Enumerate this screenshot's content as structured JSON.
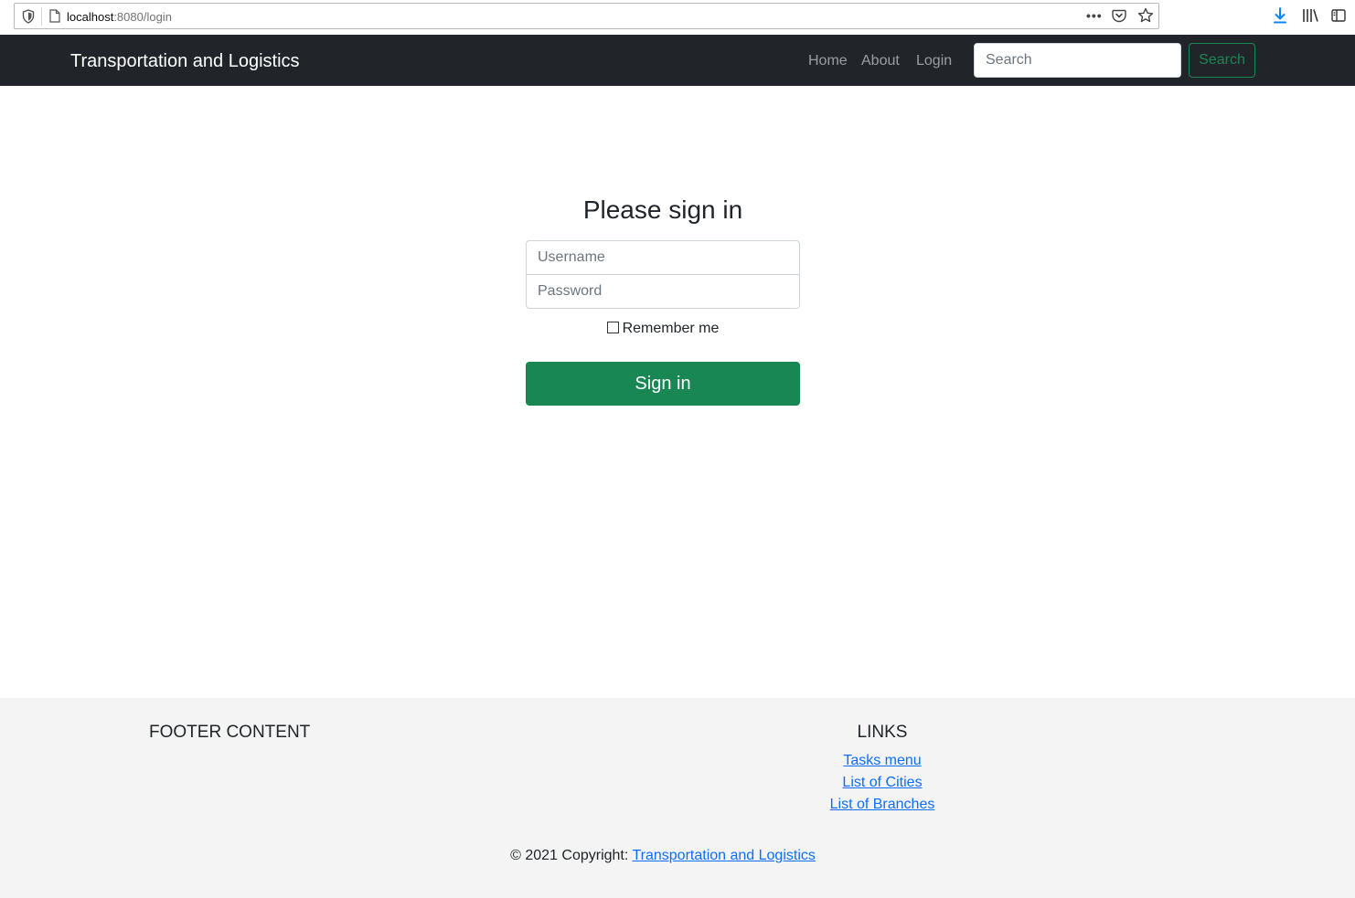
{
  "browser": {
    "url_host": "localhost",
    "url_rest": ":8080/login",
    "more_label": "•••"
  },
  "navbar": {
    "brand": "Transportation and Logistics",
    "links": [
      "Home",
      "About",
      "Login"
    ],
    "search_placeholder": "Search",
    "search_button": "Search"
  },
  "signin": {
    "title": "Please sign in",
    "username_placeholder": "Username",
    "password_placeholder": "Password",
    "remember_label": "Remember me",
    "remember_checked": false,
    "submit_label": "Sign in"
  },
  "footer": {
    "content_heading": "FOOTER CONTENT",
    "links_heading": "LINKS",
    "links": [
      "Tasks menu",
      "List of Cities",
      "List of Branches"
    ],
    "copyright_prefix": "© 2021 Copyright:",
    "copyright_link": "Transportation and Logistics"
  },
  "colors": {
    "navbar_bg": "#212529",
    "success": "#198754",
    "link": "#0d6efd",
    "footer_bg": "#f4f4f4"
  }
}
